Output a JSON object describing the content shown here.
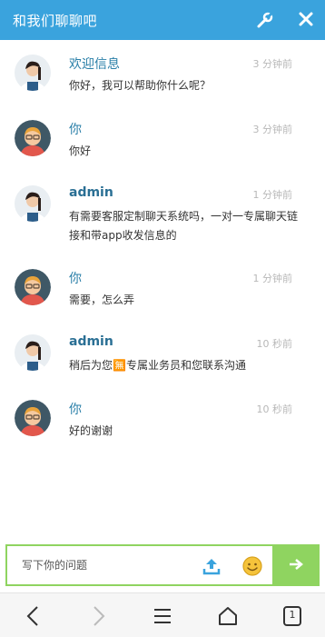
{
  "header": {
    "title": "和我们聊聊吧",
    "icons": [
      "wrench-icon",
      "close-icon"
    ],
    "color": "#3aa3dd"
  },
  "messages": [
    {
      "sender": "欢迎信息",
      "time": "3 分钟前",
      "text": "你好，我可以帮助你什么呢？",
      "role": "agent"
    },
    {
      "sender": "你",
      "time": "3 分钟前",
      "text": "你好",
      "role": "user"
    },
    {
      "sender": "admin",
      "time": "1 分钟前",
      "text": "有需要客服定制聊天系统吗，一对一专属聊天链接和带app收发信息的",
      "role": "agent"
    },
    {
      "sender": "你",
      "time": "1 分钟前",
      "text": "需要，怎么弄",
      "role": "user"
    },
    {
      "sender": "admin",
      "time": "10 秒前",
      "text": "稍后为您🈚专属业务员和您联系沟通",
      "role": "agent"
    },
    {
      "sender": "你",
      "time": "10 秒前",
      "text": "好的谢谢",
      "role": "user"
    }
  ],
  "composer": {
    "placeholder": "写下你的问题",
    "icons": [
      "upload-icon",
      "emoji-icon",
      "send-arrow-icon"
    ],
    "accent": "#8fd460"
  },
  "navbar": {
    "tab_count": "1",
    "icons": [
      "back-icon",
      "forward-icon",
      "menu-icon",
      "home-icon",
      "tabs-icon"
    ]
  }
}
